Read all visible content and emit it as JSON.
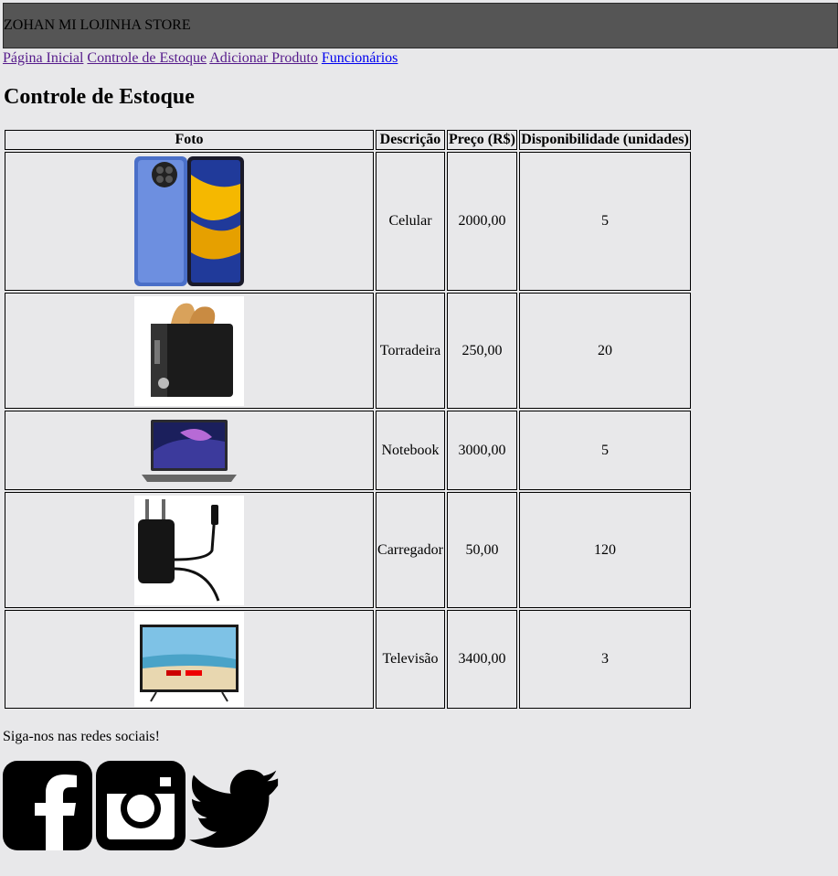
{
  "header": {
    "title": "ZOHAN MI LOJINHA STORE"
  },
  "nav": {
    "links": [
      {
        "label": "Página Inicial"
      },
      {
        "label": "Controle de Estoque"
      },
      {
        "label": "Adicionar Produto"
      },
      {
        "label": "Funcionários"
      }
    ]
  },
  "page": {
    "title": "Controle de Estoque"
  },
  "table": {
    "columns": [
      "Foto",
      "Descrição",
      "Preço (R$)",
      "Disponibilidade (unidades)"
    ],
    "rows": [
      {
        "photo": "phone-image",
        "description": "Celular",
        "price": "2000,00",
        "stock": "5"
      },
      {
        "photo": "toaster-image",
        "description": "Torradeira",
        "price": "250,00",
        "stock": "20"
      },
      {
        "photo": "laptop-image",
        "description": "Notebook",
        "price": "3000,00",
        "stock": "5"
      },
      {
        "photo": "charger-image",
        "description": "Carregador",
        "price": "50,00",
        "stock": "120"
      },
      {
        "photo": "tv-image",
        "description": "Televisão",
        "price": "3400,00",
        "stock": "3"
      }
    ]
  },
  "footer": {
    "social_text": "Siga-nos nas redes sociais!",
    "icons": [
      "facebook-icon",
      "instagram-icon",
      "twitter-icon"
    ]
  }
}
